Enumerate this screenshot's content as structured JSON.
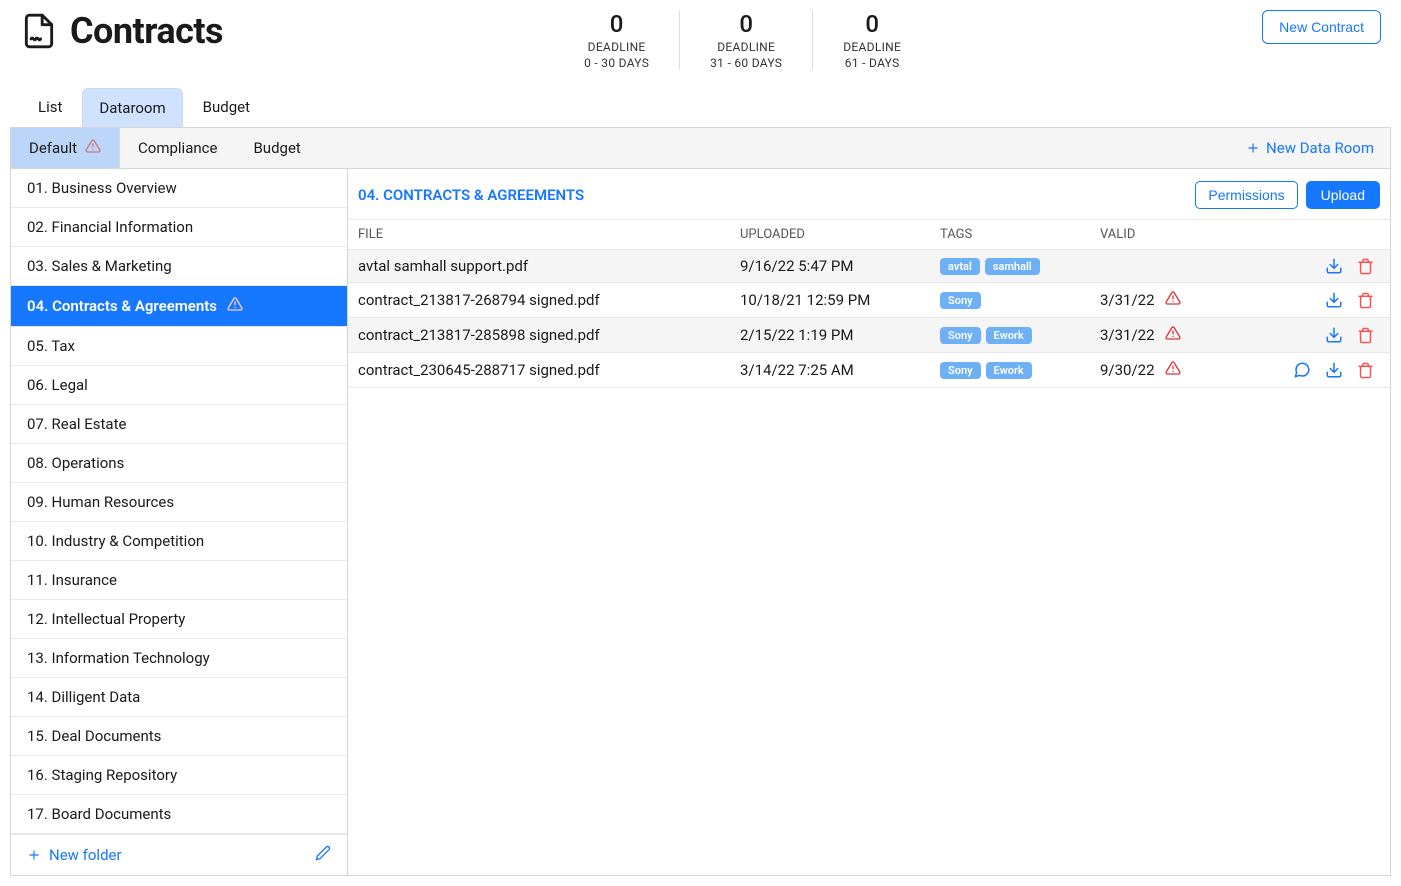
{
  "page": {
    "title": "Contracts",
    "new_contract": "New Contract"
  },
  "deadlines": [
    {
      "count": "0",
      "label1": "DEADLINE",
      "label2": "0 - 30 DAYS"
    },
    {
      "count": "0",
      "label1": "DEADLINE",
      "label2": "31 - 60 DAYS"
    },
    {
      "count": "0",
      "label1": "DEADLINE",
      "label2": "61 - DAYS"
    }
  ],
  "main_tabs": [
    {
      "label": "List",
      "active": false
    },
    {
      "label": "Dataroom",
      "active": true
    },
    {
      "label": "Budget",
      "active": false
    }
  ],
  "sub_tabs": [
    {
      "label": "Default",
      "active": true,
      "warn": true
    },
    {
      "label": "Compliance",
      "active": false,
      "warn": false
    },
    {
      "label": "Budget",
      "active": false,
      "warn": false
    }
  ],
  "new_dataroom": "New Data Room",
  "folders": [
    {
      "label": "01. Business Overview",
      "active": false,
      "warn": false
    },
    {
      "label": "02. Financial Information",
      "active": false,
      "warn": false
    },
    {
      "label": "03. Sales & Marketing",
      "active": false,
      "warn": false
    },
    {
      "label": "04. Contracts & Agreements",
      "active": true,
      "warn": true
    },
    {
      "label": "05. Tax",
      "active": false,
      "warn": false
    },
    {
      "label": "06. Legal",
      "active": false,
      "warn": false
    },
    {
      "label": "07. Real Estate",
      "active": false,
      "warn": false
    },
    {
      "label": "08. Operations",
      "active": false,
      "warn": false
    },
    {
      "label": "09. Human Resources",
      "active": false,
      "warn": false
    },
    {
      "label": "10. Industry & Competition",
      "active": false,
      "warn": false
    },
    {
      "label": "11. Insurance",
      "active": false,
      "warn": false
    },
    {
      "label": "12. Intellectual Property",
      "active": false,
      "warn": false
    },
    {
      "label": "13. Information Technology",
      "active": false,
      "warn": false
    },
    {
      "label": "14. Dilligent Data",
      "active": false,
      "warn": false
    },
    {
      "label": "15. Deal Documents",
      "active": false,
      "warn": false
    },
    {
      "label": "16. Staging Repository",
      "active": false,
      "warn": false
    },
    {
      "label": "17. Board Documents",
      "active": false,
      "warn": false
    }
  ],
  "sidebar": {
    "new_folder": "New folder"
  },
  "content": {
    "section_title": "04. CONTRACTS & AGREEMENTS",
    "permissions": "Permissions",
    "upload": "Upload",
    "columns": {
      "file": "FILE",
      "uploaded": "UPLOADED",
      "tags": "TAGS",
      "valid": "VALID"
    },
    "rows": [
      {
        "file": "avtal samhall support.pdf",
        "uploaded": "9/16/22 5:47 PM",
        "tags": [
          "avtal",
          "samhall"
        ],
        "valid": "",
        "warn": false,
        "chat": false
      },
      {
        "file": "contract_213817-268794 signed.pdf",
        "uploaded": "10/18/21 12:59 PM",
        "tags": [
          "Sony"
        ],
        "valid": "3/31/22",
        "warn": true,
        "chat": false
      },
      {
        "file": "contract_213817-285898 signed.pdf",
        "uploaded": "2/15/22 1:19 PM",
        "tags": [
          "Sony",
          "Ework"
        ],
        "valid": "3/31/22",
        "warn": true,
        "chat": false
      },
      {
        "file": "contract_230645-288717 signed.pdf",
        "uploaded": "3/14/22 7:25 AM",
        "tags": [
          "Sony",
          "Ework"
        ],
        "valid": "9/30/22",
        "warn": true,
        "chat": true
      }
    ]
  }
}
